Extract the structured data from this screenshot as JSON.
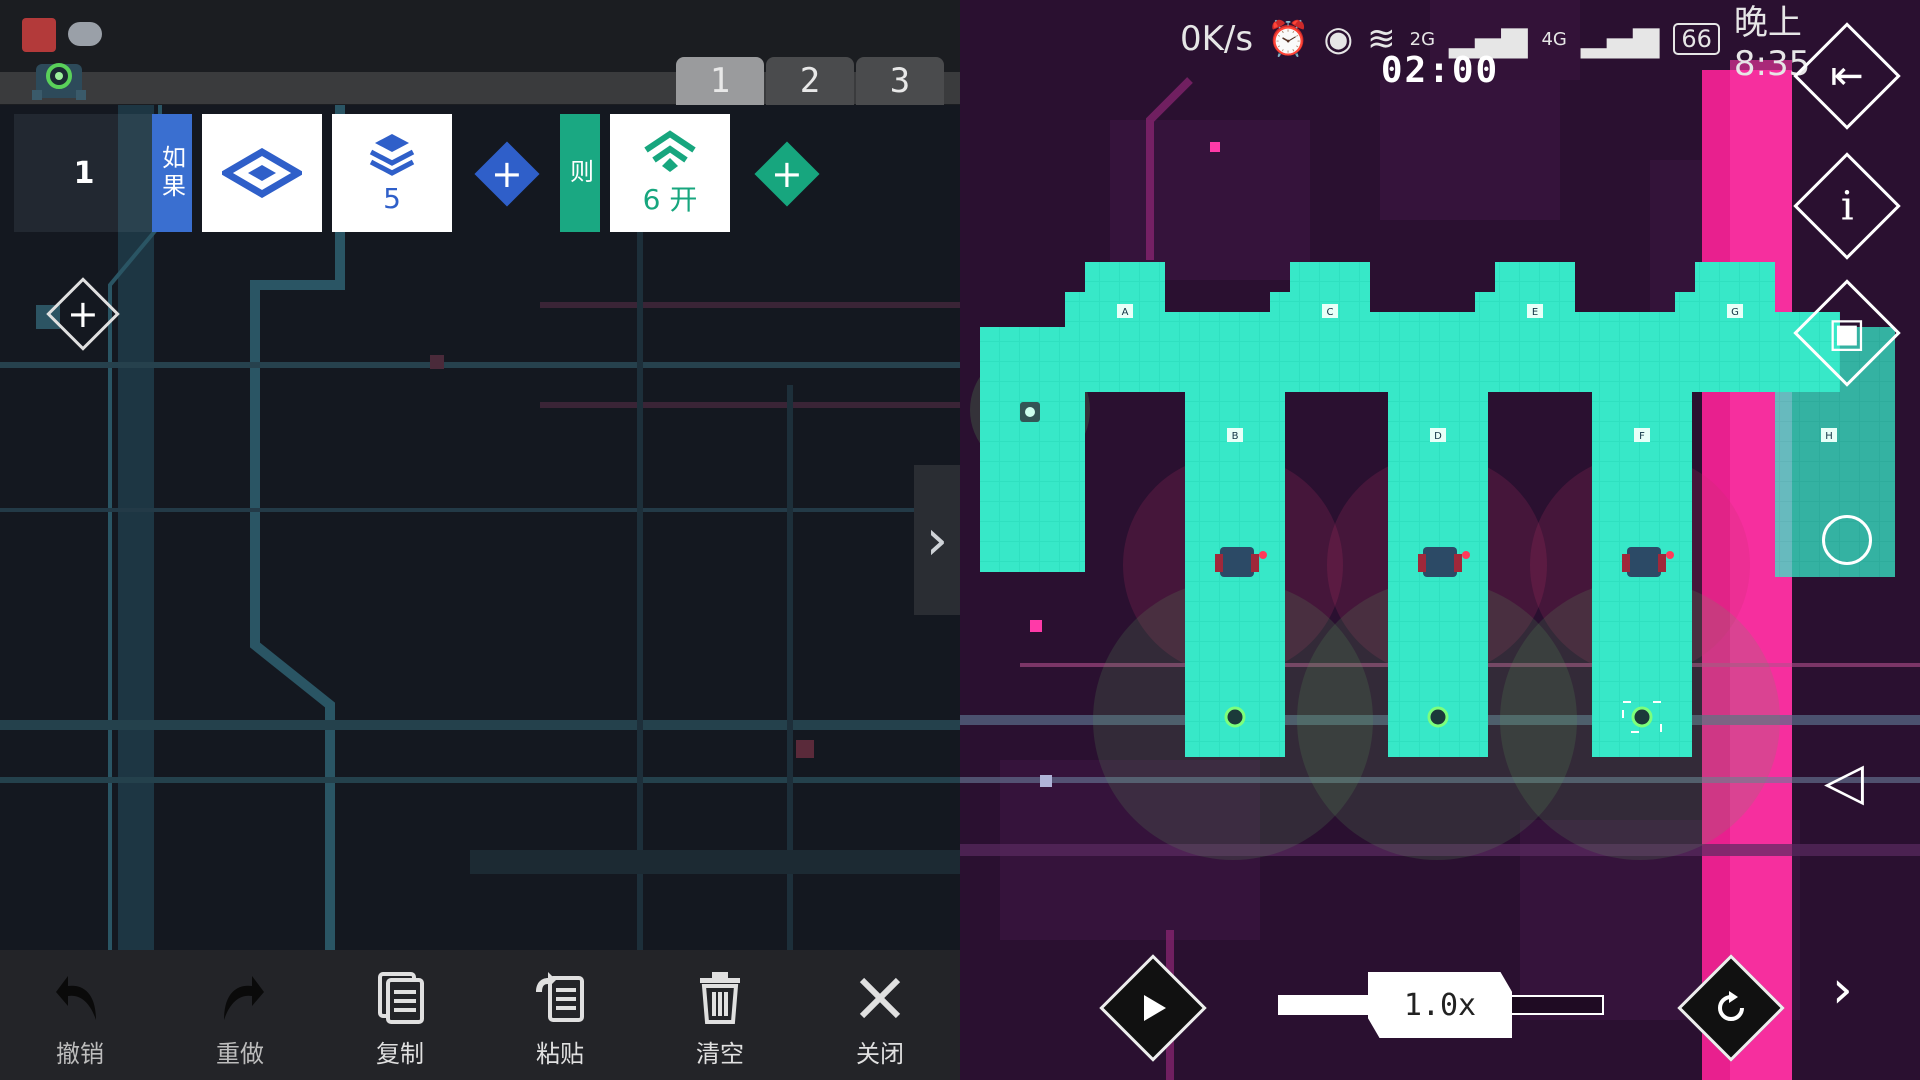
{
  "editor": {
    "page_tabs": [
      "1",
      "2",
      "3"
    ],
    "active_tab": 0,
    "rule": {
      "index": "1",
      "if_label": "如果",
      "then_label": "则",
      "condition_cards": [
        {
          "icon": "diamond-target-icon",
          "text": ""
        },
        {
          "icon": "layers-icon",
          "text": "5"
        }
      ],
      "action_cards": [
        {
          "icon": "signal-open-icon",
          "text": "6 开"
        }
      ]
    },
    "toolbar": [
      {
        "icon": "undo-icon",
        "label": "撤销"
      },
      {
        "icon": "redo-icon",
        "label": "重做"
      },
      {
        "icon": "copy-icon",
        "label": "复制"
      },
      {
        "icon": "paste-icon",
        "label": "粘贴"
      },
      {
        "icon": "trash-icon",
        "label": "清空"
      },
      {
        "icon": "close-icon",
        "label": "关闭"
      }
    ],
    "colors": {
      "if_accent": "#3a6fd0",
      "then_accent": "#1aa882"
    }
  },
  "status_bar": {
    "net_speed": "0K/s",
    "net_2g": "2G",
    "net_4g": "4G",
    "battery": "66",
    "time": "晚上8:35"
  },
  "game": {
    "timer": "02:00",
    "speed": "1.0x",
    "speed_level": 0.5,
    "room_labels": [
      "A",
      "B",
      "C",
      "D",
      "E",
      "F",
      "G",
      "H"
    ],
    "colors": {
      "floor": "#2fe0c0",
      "background": "#2a1030",
      "neon": "#ff2aa0"
    }
  }
}
